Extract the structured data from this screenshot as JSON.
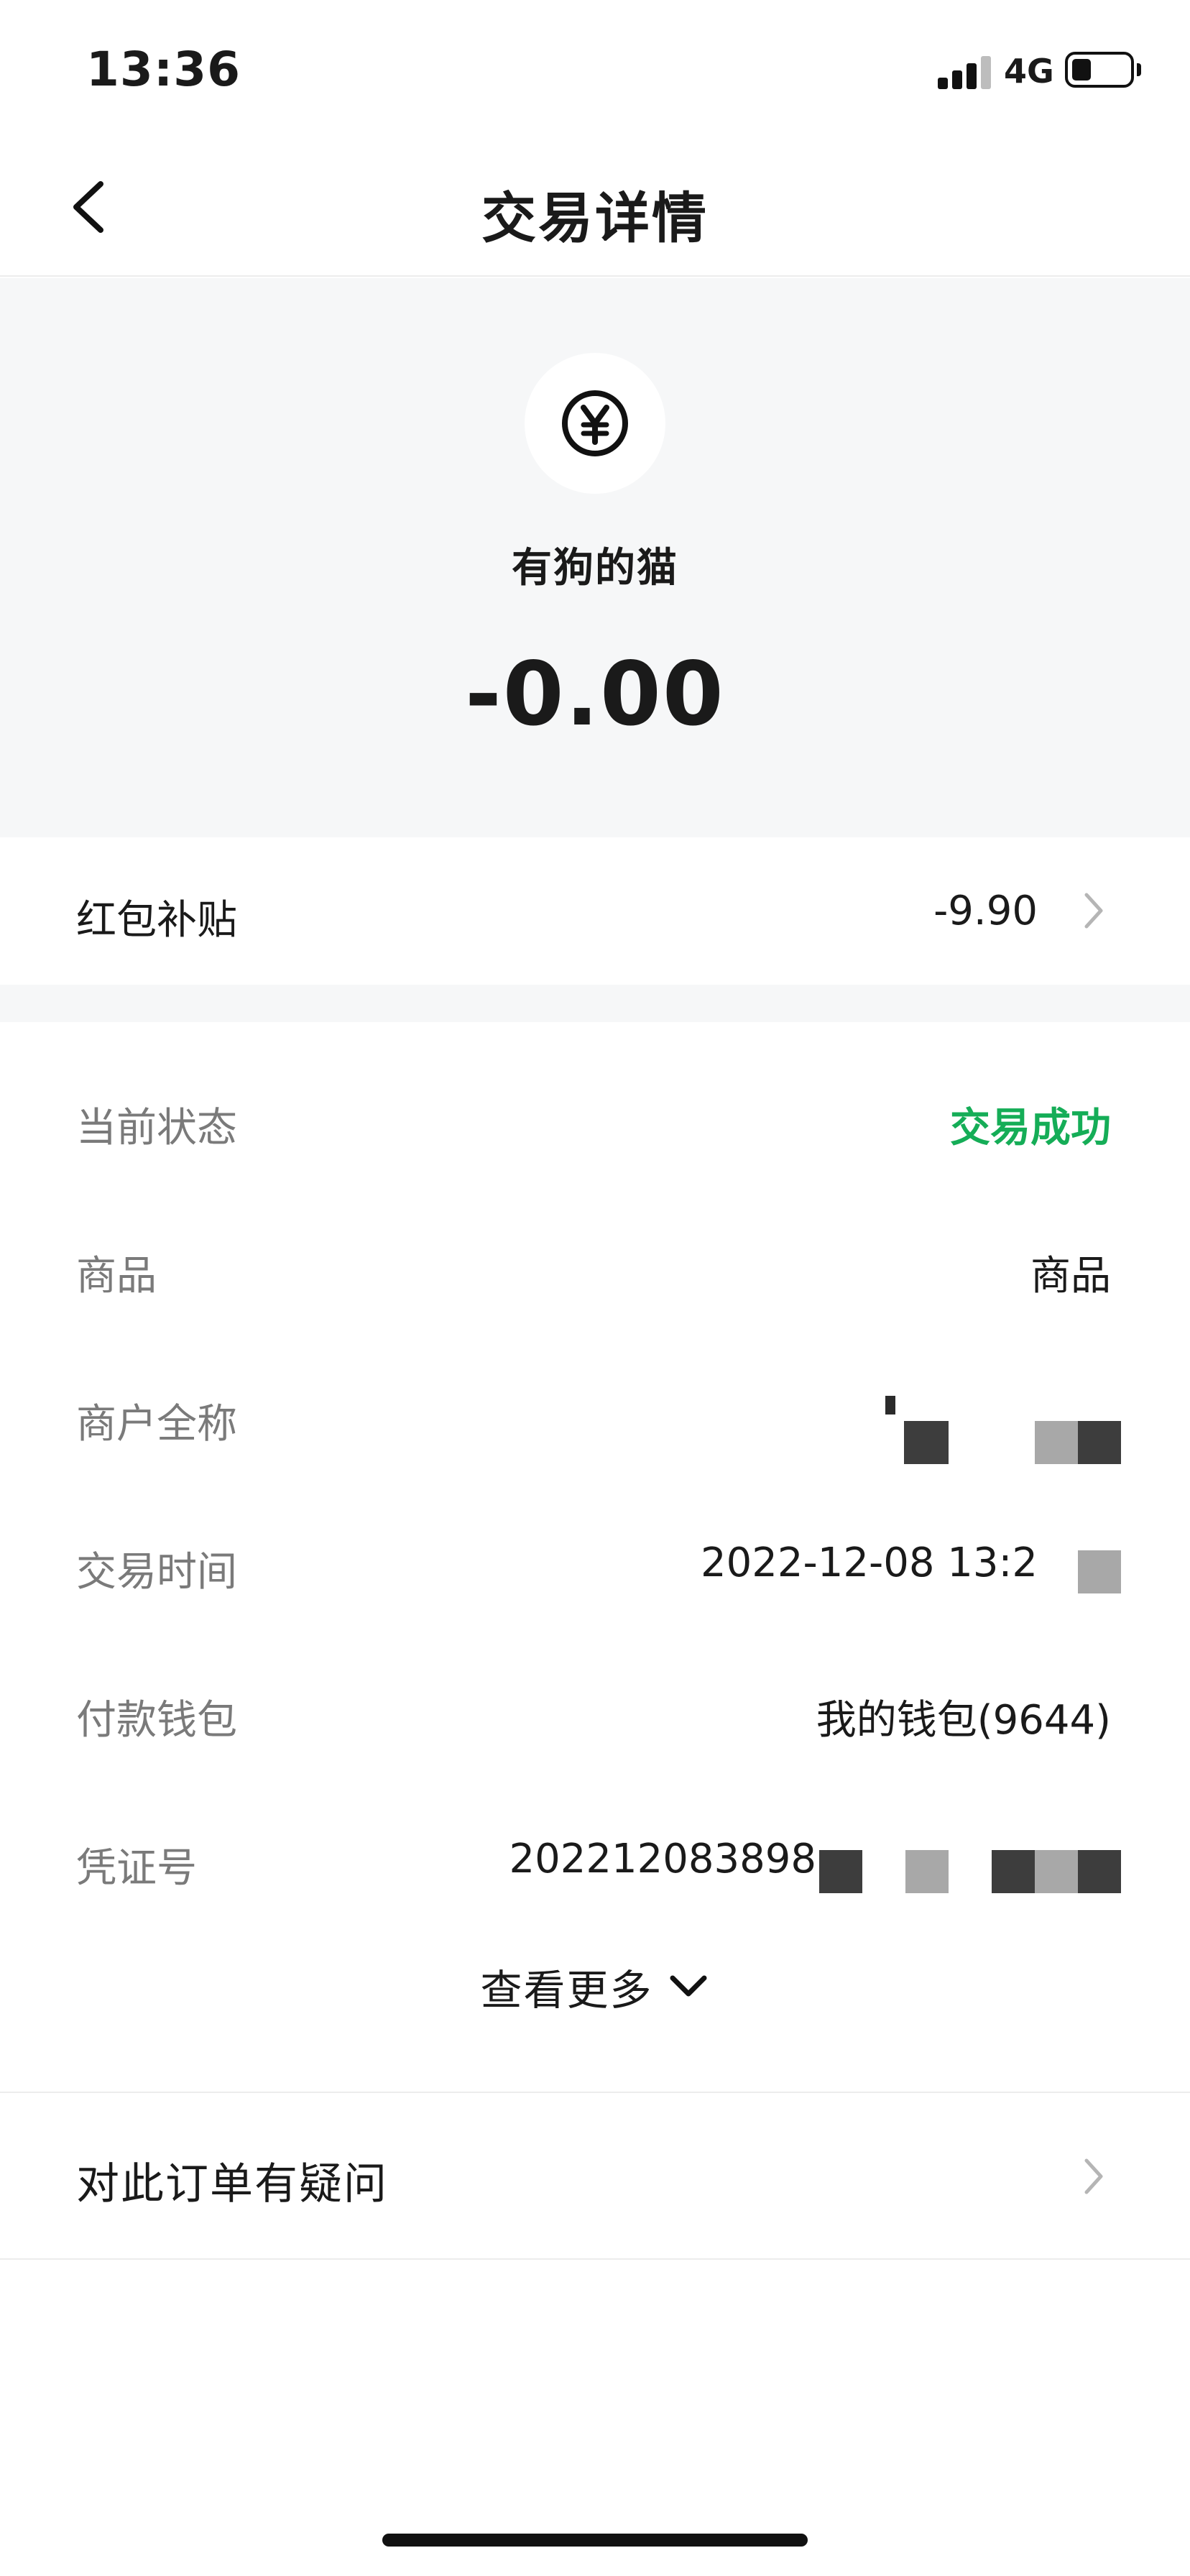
{
  "status_bar": {
    "time": "13:36",
    "network": "4G",
    "battery_fraction": 0.3
  },
  "nav": {
    "title": "交易详情"
  },
  "header": {
    "icon": "yen-icon",
    "merchant": "有狗的猫",
    "amount": "-0.00"
  },
  "subsidy": {
    "label": "红包补贴",
    "value": "-9.90"
  },
  "details": {
    "status_label": "当前状态",
    "status_value": "交易成功",
    "status_color": "#15ad57",
    "goods_label": "商品",
    "goods_value": "商品",
    "merchant_full_label": "商户全称",
    "merchant_full_value": "",
    "time_label": "交易时间",
    "time_value": "2022-12-08 13:2",
    "wallet_label": "付款钱包",
    "wallet_value": "我的钱包(9644)",
    "voucher_label": "凭证号",
    "voucher_value": "202212083898"
  },
  "view_more": {
    "label": "查看更多"
  },
  "question": {
    "label": "对此订单有疑问"
  }
}
